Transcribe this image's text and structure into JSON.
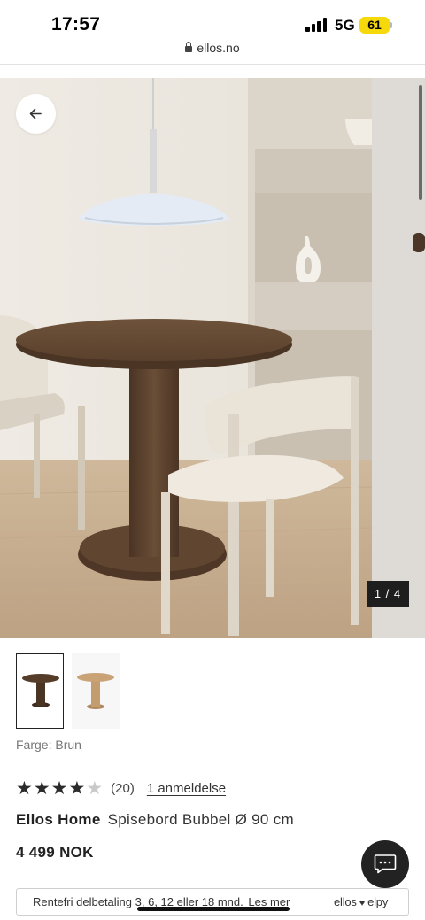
{
  "status_bar": {
    "time": "17:57",
    "network": "5G",
    "battery": "61",
    "signal_icon": "signal-bars-icon"
  },
  "browser": {
    "url": "ellos.no",
    "lock_icon": "lock-icon"
  },
  "gallery": {
    "counter": "1 / 4",
    "current_image": 1,
    "total_images": 4,
    "back_icon": "arrow-left-icon"
  },
  "thumbnails": [
    {
      "variant": "brown",
      "selected": true
    },
    {
      "variant": "natural",
      "selected": false
    }
  ],
  "color": {
    "label": "Farge: Brun"
  },
  "rating": {
    "value": 4,
    "max": 5,
    "count_text": "(20)",
    "review_link": "1 anmeldelse"
  },
  "product": {
    "brand": "Ellos Home",
    "name": "Spisebord Bubbel Ø 90 cm",
    "price": "4 499 NOK"
  },
  "chat": {
    "icon": "chat-bubble-icon"
  },
  "financing": {
    "text": "Rentefri delbetaling 3, 6, 12 eller 18 mnd.",
    "link": "Les mer",
    "logo_left": "ellos",
    "logo_right": "elpy"
  },
  "colors": {
    "dark": "#222222",
    "battery": "#f5d90a",
    "counter_bg": "#1e1e1e",
    "table_wood": "#5c4330"
  }
}
